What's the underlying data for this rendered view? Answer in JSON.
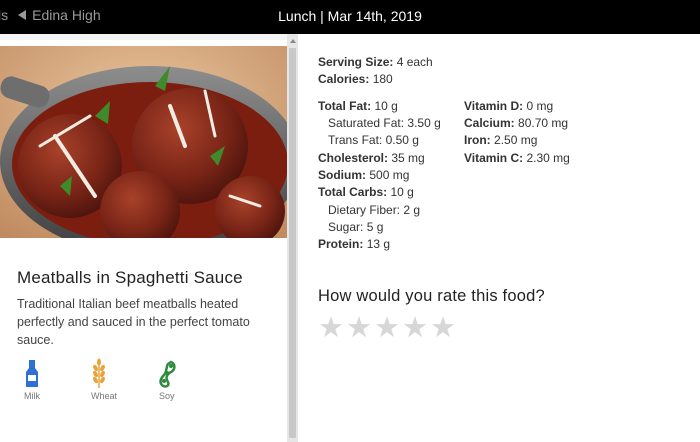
{
  "topbar": {
    "left_fragment": "ls",
    "school": "Edina High",
    "title": "Lunch | Mar 14th, 2019"
  },
  "food": {
    "name": "Meatballs in Spaghetti Sauce",
    "description": "Traditional Italian beef meatballs heated perfectly and sauced in the perfect tomato sauce.",
    "image": "meatballs-photo",
    "allergens": [
      {
        "label": "Milk",
        "icon": "milk-bottle-icon",
        "color": "#2f6fd6"
      },
      {
        "label": "Wheat",
        "icon": "wheat-icon",
        "color": "#e8a23a"
      },
      {
        "label": "Soy",
        "icon": "soybean-icon",
        "color": "#2e8b3e"
      }
    ]
  },
  "nutrition": {
    "serving_label": "Serving Size:",
    "serving_value": "4 each",
    "calories_label": "Calories:",
    "calories_value": "180",
    "total_fat_label": "Total Fat:",
    "total_fat_value": "10 g",
    "sat_fat_label": "Saturated Fat:",
    "sat_fat_value": "3.50 g",
    "trans_fat_label": "Trans Fat:",
    "trans_fat_value": "0.50 g",
    "cholesterol_label": "Cholesterol:",
    "cholesterol_value": "35 mg",
    "sodium_label": "Sodium:",
    "sodium_value": "500 mg",
    "carbs_label": "Total Carbs:",
    "carbs_value": "10 g",
    "fiber_label": "Dietary Fiber:",
    "fiber_value": "2 g",
    "sugar_label": "Sugar:",
    "sugar_value": "5 g",
    "protein_label": "Protein:",
    "protein_value": "13 g",
    "vitd_label": "Vitamin D:",
    "vitd_value": "0 mg",
    "calcium_label": "Calcium:",
    "calcium_value": "80.70 mg",
    "iron_label": "Iron:",
    "iron_value": "2.50 mg",
    "vitc_label": "Vitamin C:",
    "vitc_value": "2.30 mg"
  },
  "rating": {
    "question": "How would you rate this food?",
    "stars": 5,
    "rating_value": 0,
    "star_color": "#d7d7d7"
  }
}
